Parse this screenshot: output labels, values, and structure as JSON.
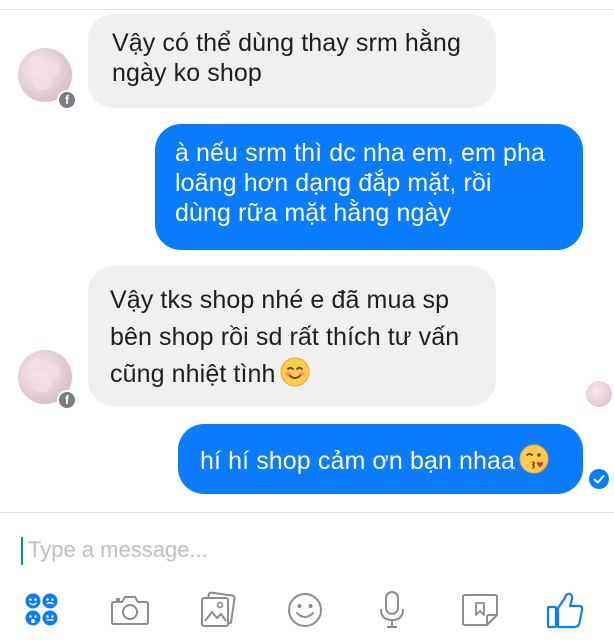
{
  "conversation": {
    "messages": [
      {
        "id": "m1",
        "direction": "incoming",
        "lines": [
          "Vậy có thể dùng thay srm hằng",
          "ngày ko shop"
        ]
      },
      {
        "id": "m2",
        "direction": "outgoing",
        "lines": [
          "à nếu srm thì dc nha em, em pha",
          "loãng hơn dạng đắp mặt, rồi",
          "dùng rữa mặt hằng ngày"
        ]
      },
      {
        "id": "m3",
        "direction": "incoming",
        "lines": [
          "Vậy tks shop nhé e đã mua sp",
          "bên shop rồi sd rất thích tư vấn",
          "cũng nhiệt tình"
        ],
        "emoji": "smiling-face-icon"
      },
      {
        "id": "m4",
        "direction": "outgoing",
        "lines": [
          "hí hí shop cảm ơn bạn nhaa"
        ],
        "emoji": "face-blowing-kiss-icon"
      }
    ],
    "badge_icon": "facebook-f-icon",
    "status": {
      "read_receipt": "seen-avatar",
      "delivered_icon": "check-circle-icon"
    }
  },
  "composer": {
    "placeholder": "Type a message..."
  },
  "toolbar": {
    "icons": [
      "apps-icon",
      "camera-icon",
      "gallery-icon",
      "emoji-icon",
      "microphone-icon",
      "sticker-icon",
      "like-icon"
    ]
  },
  "colors": {
    "outgoing_bubble": "#0a7cff",
    "incoming_bubble": "#f1f0f0",
    "accent": "#0a7cff",
    "toolbar_icon": "#0a7cff"
  }
}
